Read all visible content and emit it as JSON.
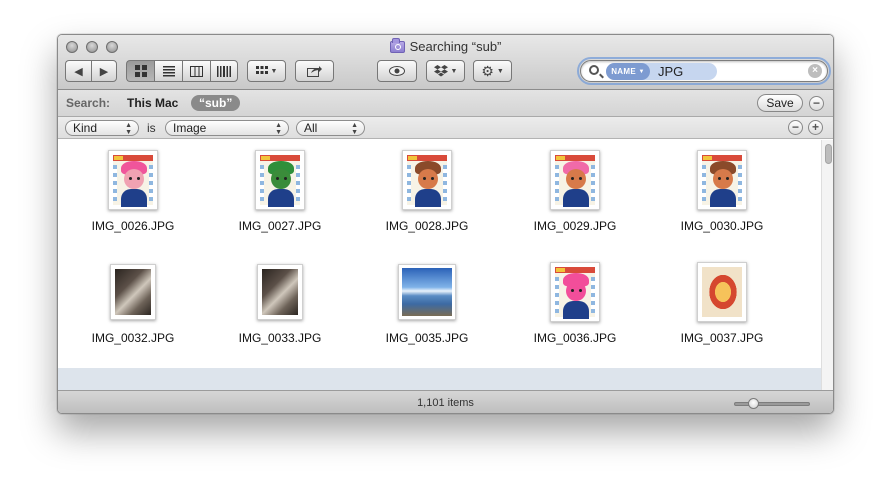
{
  "window": {
    "title": "Searching “sub”"
  },
  "toolbar": {
    "back_icon": "back-arrow-icon",
    "forward_icon": "forward-arrow-icon",
    "view_modes": [
      "icon-view",
      "list-view",
      "column-view",
      "coverflow-view"
    ],
    "active_view": "icon-view"
  },
  "search": {
    "token_badge": "NAME",
    "token_text": "JPG",
    "value": ""
  },
  "scope": {
    "label": "Search:",
    "this_mac": "This Mac",
    "sub": "“sub”",
    "save": "Save"
  },
  "criteria": {
    "attribute": "Kind",
    "is": "is",
    "value": "Image",
    "sub_value": "All"
  },
  "items": [
    {
      "name": "IMG_0026.JPG",
      "type": "toy",
      "hair": "#f0559b",
      "skin": "#f0a2b2"
    },
    {
      "name": "IMG_0027.JPG",
      "type": "toy",
      "hair": "#2f8f3a",
      "skin": "#3a8c3a"
    },
    {
      "name": "IMG_0028.JPG",
      "type": "toy",
      "hair": "#8a4a2a",
      "skin": "#d77a4a"
    },
    {
      "name": "IMG_0029.JPG",
      "type": "toy",
      "hair": "#f06aa8",
      "skin": "#d77a4a"
    },
    {
      "name": "IMG_0030.JPG",
      "type": "toy",
      "hair": "#8a4a2a",
      "skin": "#d77a4a"
    },
    {
      "name": "IMG_0032.JPG",
      "type": "room"
    },
    {
      "name": "IMG_0033.JPG",
      "type": "room"
    },
    {
      "name": "IMG_0035.JPG",
      "type": "sea"
    },
    {
      "name": "IMG_0036.JPG",
      "type": "toy",
      "hair": "#f24e9a",
      "skin": "#f24e9a"
    },
    {
      "name": "IMG_0037.JPG",
      "type": "circle"
    }
  ],
  "status": {
    "count": "1,101 items",
    "zoom": 0.25
  }
}
